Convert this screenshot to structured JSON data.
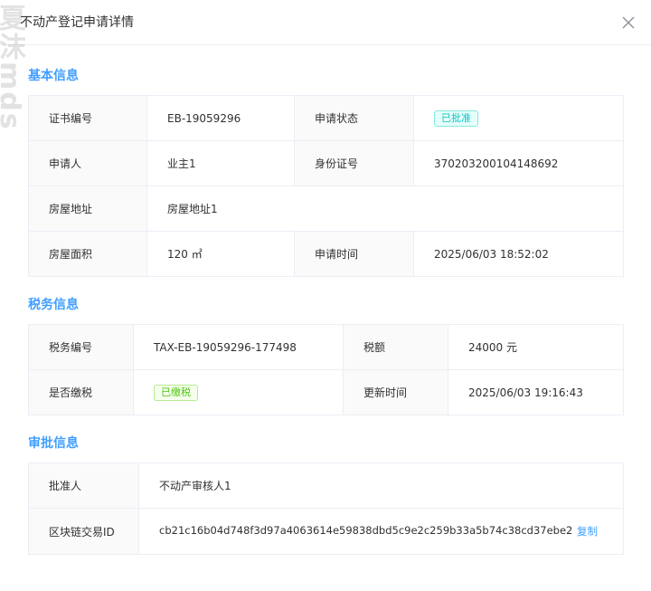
{
  "dialog": {
    "title": "不动产登记申请详情",
    "close_icon": "close-icon"
  },
  "watermark": "夏沫mds",
  "basic": {
    "title": "基本信息",
    "cert_no_label": "证书编号",
    "cert_no": "EB-19059296",
    "status_label": "申请状态",
    "status": "已批准",
    "applicant_label": "申请人",
    "applicant": "业主1",
    "id_label": "身份证号",
    "id_no": "370203200104148692",
    "address_label": "房屋地址",
    "address": "房屋地址1",
    "area_label": "房屋面积",
    "area": "120 ㎡",
    "time_label": "申请时间",
    "time": "2025/06/03 18:52:02"
  },
  "tax": {
    "title": "税务信息",
    "no_label": "税务编号",
    "no": "TAX-EB-19059296-177498",
    "amount_label": "税额",
    "amount": "24000 元",
    "paid_label": "是否缴税",
    "paid": "已缴税",
    "update_label": "更新时间",
    "update": "2025/06/03 19:16:43"
  },
  "approval": {
    "title": "审批信息",
    "approver_label": "批准人",
    "approver": "不动产审核人1",
    "tx_label": "区块链交易ID",
    "tx_id": "cb21c16b04d748f3d97a4063614e59838dbd5c9e2c259b33a5b74c38cd37ebe2",
    "copy": "复制"
  },
  "colors": {
    "accent": "#409eff",
    "approved": "#13c2c2",
    "paid": "#52c41a"
  }
}
